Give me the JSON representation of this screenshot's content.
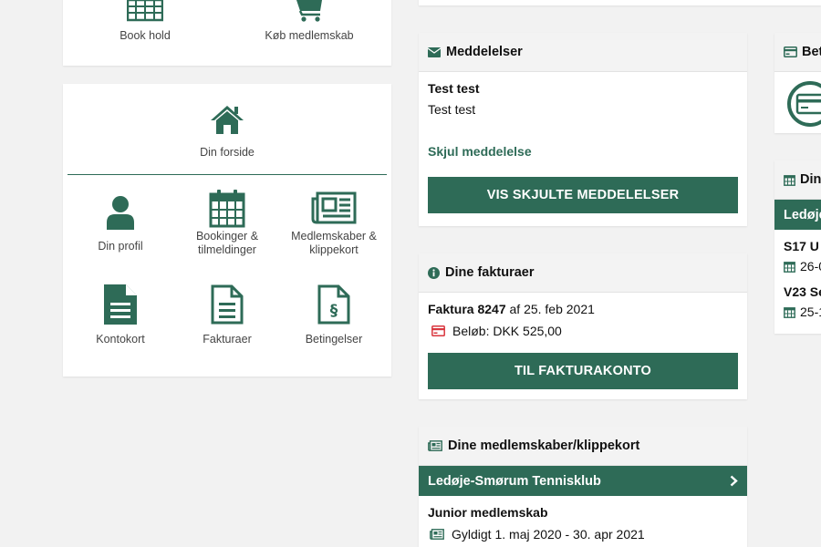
{
  "quick_actions": [
    {
      "label": "Book hold",
      "icon": "calendar-icon"
    },
    {
      "label": "Køb medlemskab",
      "icon": "cart-icon"
    }
  ],
  "nav": {
    "home": {
      "label": "Din forside",
      "icon": "home-icon"
    },
    "tiles": [
      {
        "label": "Din profil",
        "icon": "user-icon"
      },
      {
        "label": "Bookinger & tilmeldinger",
        "icon": "calendar-icon"
      },
      {
        "label": "Medlemskaber & klippekort",
        "icon": "newspaper-icon"
      },
      {
        "label": "Kontokort",
        "icon": "document-icon"
      },
      {
        "label": "Fakturaer",
        "icon": "document-outline-icon"
      },
      {
        "label": "Betingelser",
        "icon": "terms-icon"
      }
    ]
  },
  "messages": {
    "header": "Meddelelser",
    "title": "Test test",
    "text": "Test test",
    "hide_link": "Skjul meddelelse",
    "button": "VIS SKJULTE MEDDELELSER"
  },
  "invoices": {
    "header": "Dine fakturaer",
    "invoice_label": "Faktura 8247",
    "invoice_date": "af 25. feb 2021",
    "amount": "Beløb: DKK 525,00",
    "button": "TIL FAKTURAKONTO"
  },
  "memberships": {
    "header": "Dine medlemskaber/klippekort",
    "club": "Ledøje-Smørum Tennisklub",
    "membership": "Junior medlemskab",
    "valid": "Gyldigt 1. maj 2020 - 30. apr 2021"
  },
  "right": {
    "payment_header": "Bet",
    "bookings_header": "Din",
    "club_bar": "Ledøje",
    "rows": [
      {
        "title": "S17 U",
        "date": "26-0"
      },
      {
        "title": "V23 Se",
        "date": "25-1"
      }
    ]
  },
  "colors": {
    "brand": "#2e6b57",
    "danger": "#d9363e",
    "background": "#f2f2f2"
  }
}
